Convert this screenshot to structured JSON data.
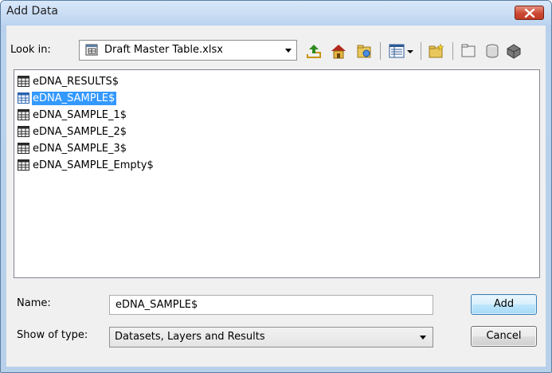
{
  "window": {
    "title": "Add Data"
  },
  "lookin": {
    "label": "Look in:",
    "value": "Draft Master Table.xlsx"
  },
  "toolbar": {
    "icons": [
      "up-one-level-icon",
      "home-icon",
      "connect-folder-icon",
      "view-details-icon",
      "view-dropdown-icon",
      "new-folder-icon",
      "new-item-icon",
      "catalog-icon",
      "database-icon"
    ]
  },
  "list": {
    "items": [
      {
        "label": "eDNA_RESULTS$",
        "selected": false
      },
      {
        "label": "eDNA_SAMPLE$",
        "selected": true
      },
      {
        "label": "eDNA_SAMPLE_1$",
        "selected": false
      },
      {
        "label": "eDNA_SAMPLE_2$",
        "selected": false
      },
      {
        "label": "eDNA_SAMPLE_3$",
        "selected": false
      },
      {
        "label": "eDNA_SAMPLE_Empty$",
        "selected": false
      }
    ]
  },
  "form": {
    "name_label": "Name:",
    "name_value": "eDNA_SAMPLE$",
    "type_label": "Show of type:",
    "type_value": "Datasets, Layers and Results"
  },
  "buttons": {
    "add": "Add",
    "cancel": "Cancel"
  },
  "colors": {
    "selection": "#3399ff",
    "close_button": "#cc4a34",
    "title_bar": "#c7dcf3"
  }
}
